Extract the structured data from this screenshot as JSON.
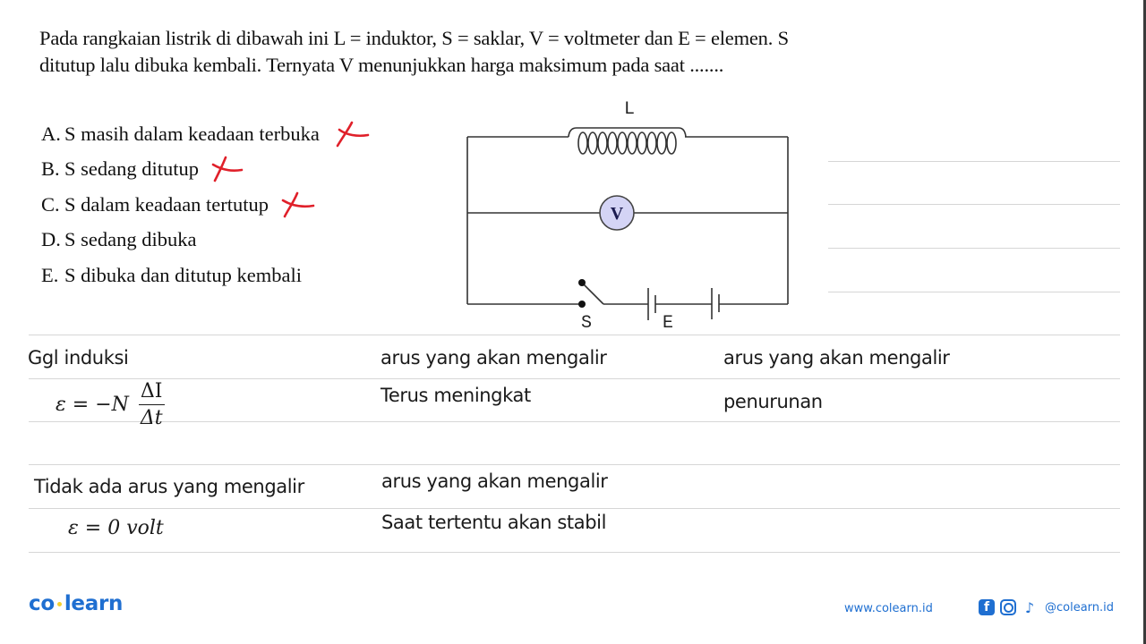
{
  "question": {
    "text": "Pada rangkaian listrik di dibawah ini L = induktor, S = saklar, V = voltmeter dan E = elemen. S ditutup lalu dibuka kembali. Ternyata V menunjukkan harga maksimum pada saat ......."
  },
  "options": [
    {
      "letter": "A.",
      "text": "S masih dalam keadaan terbuka",
      "marked_wrong": true
    },
    {
      "letter": "B.",
      "text": "S sedang ditutup",
      "marked_wrong": true
    },
    {
      "letter": "C.",
      "text": "S dalam keadaan tertutup",
      "marked_wrong": true
    },
    {
      "letter": "D.",
      "text": "S sedang dibuka",
      "marked_wrong": false
    },
    {
      "letter": "E.",
      "text": "S dibuka dan ditutup kembali",
      "marked_wrong": false
    }
  ],
  "circuit": {
    "inductor_label": "L",
    "voltmeter_label": "V",
    "switch_label": "S",
    "element_label": "E",
    "voltmeter_fill": "#d4d4f5",
    "wire_color": "#333333"
  },
  "notes": {
    "col1_header": "Ggl induksi",
    "formula_lhs": "ε = −N",
    "formula_num": "ΔI",
    "formula_den": "Δt",
    "col2_header": "arus yang akan mengalir",
    "col2_value": "Terus meningkat",
    "col3_header": "arus yang akan mengalir",
    "col3_value": "penurunan",
    "row2_col1": "Tidak ada arus yang mengalir",
    "row2_formula": "ε = 0 volt",
    "row2_col2_header": "arus yang akan mengalir",
    "row2_col2_value": "Saat tertentu akan stabil"
  },
  "footer": {
    "logo_left": "co",
    "logo_right": "learn",
    "website": "www.colearn.id",
    "handle": "@colearn.id",
    "brand_color": "#1f6fd1",
    "cross_color": "#e0202a"
  }
}
